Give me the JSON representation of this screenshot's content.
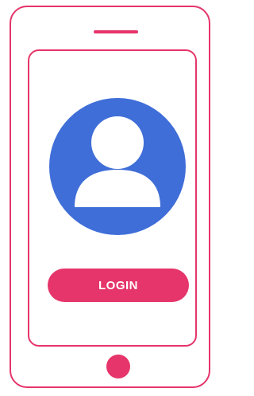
{
  "phone": {
    "accent_color": "#e5356a",
    "avatar_color": "#3f6ed8",
    "avatar_icon": "user-icon",
    "login_label": "LOGIN"
  }
}
